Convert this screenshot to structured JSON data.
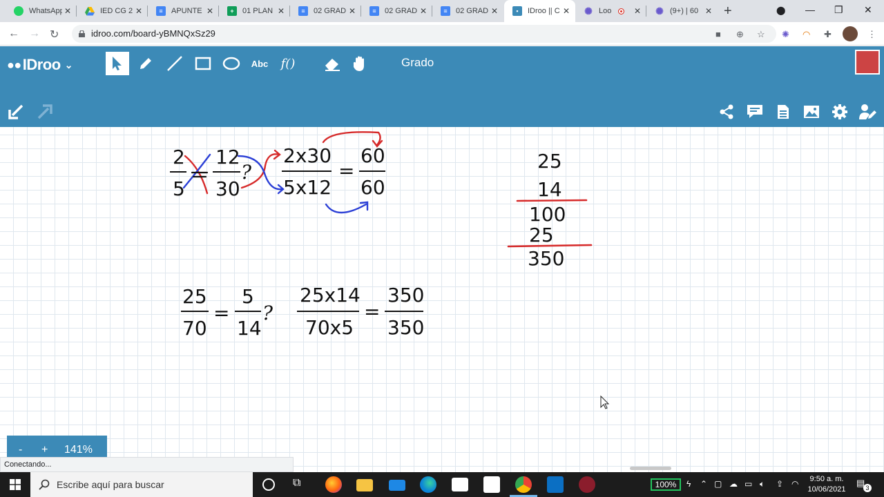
{
  "browser": {
    "tabs": [
      {
        "label": "WhatsApp",
        "favicon_color": "#25d366",
        "favicon": "whatsapp-icon",
        "active": false
      },
      {
        "label": "IED CG 2",
        "favicon_color": "#f4b400",
        "favicon": "drive-icon",
        "active": false
      },
      {
        "label": "APUNTE",
        "favicon_color": "#4285f4",
        "favicon": "docs-icon",
        "active": false
      },
      {
        "label": "01 PLAN",
        "favicon_color": "#0f9d58",
        "favicon": "sheets-icon",
        "active": false
      },
      {
        "label": "02 GRAD",
        "favicon_color": "#4285f4",
        "favicon": "docs-icon",
        "active": false
      },
      {
        "label": "02 GRAD",
        "favicon_color": "#4285f4",
        "favicon": "docs-icon",
        "active": false
      },
      {
        "label": "02 GRAD",
        "favicon_color": "#4285f4",
        "favicon": "docs-icon",
        "active": false
      },
      {
        "label": "IDroo || C",
        "favicon_color": "#3c8ab7",
        "favicon": "idroo-icon",
        "active": true
      },
      {
        "label": "Loo",
        "favicon_color": "#6a5acd",
        "favicon": "gear-flower-icon",
        "active": false,
        "recording": true
      },
      {
        "label": "(9+) | 60",
        "favicon_color": "#6a5acd",
        "favicon": "gear-flower-icon",
        "active": false
      }
    ],
    "url": "idroo.com/board-yBMNQxSz29"
  },
  "app": {
    "brand": "IDroo",
    "board_title": "Grado",
    "tools": {
      "text_tool": "Abc",
      "function_tool": "f()"
    }
  },
  "board": {
    "eq1": {
      "a_num": "2",
      "a_den": "5",
      "b_num": "12",
      "b_den": "30",
      "question": "?",
      "c_num": "2x30",
      "c_den": "5x12",
      "equals": "=",
      "d_num": "60",
      "d_den": "60"
    },
    "eq2": {
      "a_num": "25",
      "a_den": "70",
      "equals": "=",
      "b_num": "5",
      "b_den": "14",
      "question": "?",
      "c_num": "25x14",
      "c_den": "70x5",
      "d_num": "350",
      "d_den": "350"
    },
    "mult": {
      "top": "25",
      "mult": "14",
      "partial1": "100",
      "partial2": "25",
      "result": "350"
    }
  },
  "zoom": {
    "minus": "-",
    "plus": "+",
    "level": "141%"
  },
  "status": "Conectando...",
  "taskbar": {
    "search_placeholder": "Escribe aquí para buscar",
    "battery": "100%",
    "time": "9:50 a. m.",
    "date": "10/06/2021",
    "notifications": "3"
  },
  "colors": {
    "toolbar": "#3c8ab7",
    "ink_red": "#d62a2a",
    "ink_blue": "#2b3fd6"
  }
}
